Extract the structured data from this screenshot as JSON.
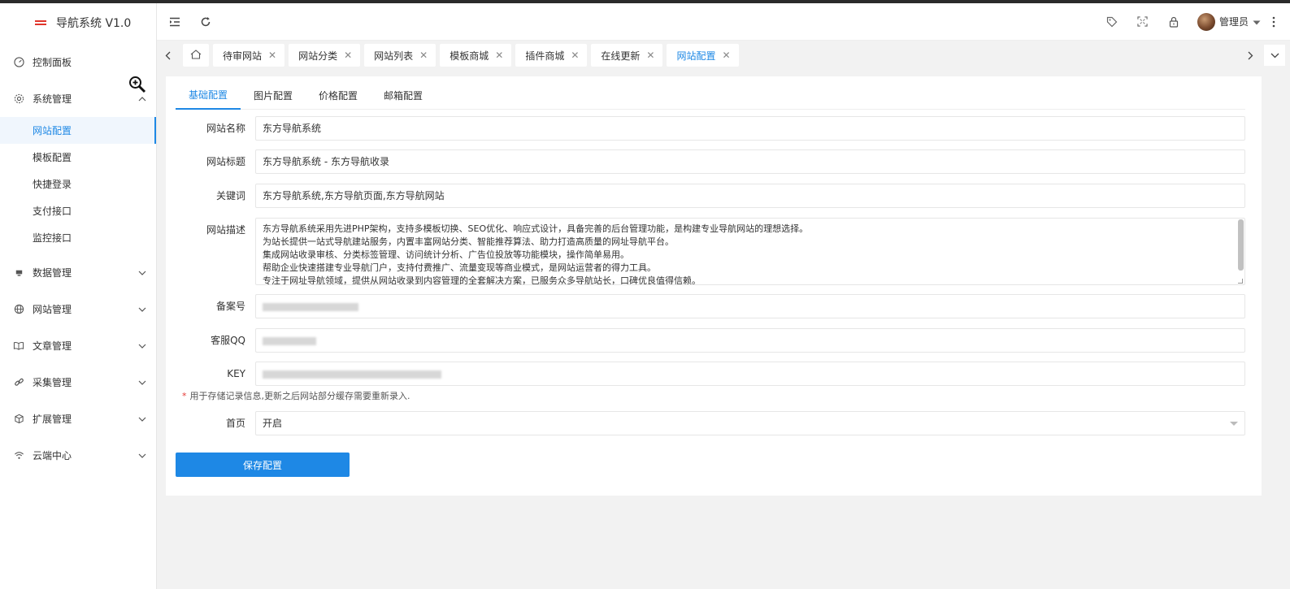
{
  "app": {
    "title": "导航系统 V1.0"
  },
  "sidebar": {
    "items": [
      {
        "label": "控制面板",
        "icon": "dashboard-icon"
      },
      {
        "label": "系统管理",
        "icon": "gear-icon",
        "expanded": true,
        "children": [
          {
            "label": "网站配置",
            "active": true
          },
          {
            "label": "模板配置"
          },
          {
            "label": "快捷登录"
          },
          {
            "label": "支付接口"
          },
          {
            "label": "监控接口"
          }
        ]
      },
      {
        "label": "数据管理",
        "icon": "monitor-icon"
      },
      {
        "label": "网站管理",
        "icon": "globe-icon"
      },
      {
        "label": "文章管理",
        "icon": "book-icon"
      },
      {
        "label": "采集管理",
        "icon": "link-icon"
      },
      {
        "label": "扩展管理",
        "icon": "cube-icon"
      },
      {
        "label": "云端中心",
        "icon": "wifi-icon"
      }
    ]
  },
  "header": {
    "user_name": "管理员"
  },
  "tabs": [
    {
      "label": "待审网站"
    },
    {
      "label": "网站分类"
    },
    {
      "label": "网站列表"
    },
    {
      "label": "模板商城"
    },
    {
      "label": "插件商城"
    },
    {
      "label": "在线更新"
    },
    {
      "label": "网站配置",
      "active": true
    }
  ],
  "config_tabs": [
    {
      "label": "基础配置",
      "active": true
    },
    {
      "label": "图片配置"
    },
    {
      "label": "价格配置"
    },
    {
      "label": "邮箱配置"
    }
  ],
  "form": {
    "site_name": {
      "label": "网站名称",
      "value": "东方导航系统"
    },
    "site_title": {
      "label": "网站标题",
      "value": "东方导航系统 - 东方导航收录"
    },
    "keywords": {
      "label": "关键词",
      "value": "东方导航系统,东方导航页面,东方导航网站"
    },
    "description": {
      "label": "网站描述",
      "lines": [
        "东方导航系统采用先进PHP架构，支持多模板切换、SEO优化、响应式设计，具备完善的后台管理功能，是构建专业导航网站的理想选择。",
        "为站长提供一站式导航建站服务，内置丰富网站分类、智能推荐算法、助力打造高质量的网址导航平台。",
        "集成网站收录审核、分类标签管理、访问统计分析、广告位投放等功能模块，操作简单易用。",
        "帮助企业快速搭建专业导航门户，支持付费推广、流量变现等商业模式，是网站运营者的得力工具。",
        "专注于网址导航领域，提供从网站收录到内容管理的全套解决方案，已服务众多导航站长，口碑优良值得信赖。"
      ]
    },
    "icp": {
      "label": "备案号"
    },
    "qq": {
      "label": "客服QQ"
    },
    "key": {
      "label": "KEY"
    },
    "hint": "用于存储记录信息,更新之后网站部分缓存需要重新录入.",
    "homepage": {
      "label": "首页",
      "value": "开启"
    },
    "save_label": "保存配置"
  }
}
